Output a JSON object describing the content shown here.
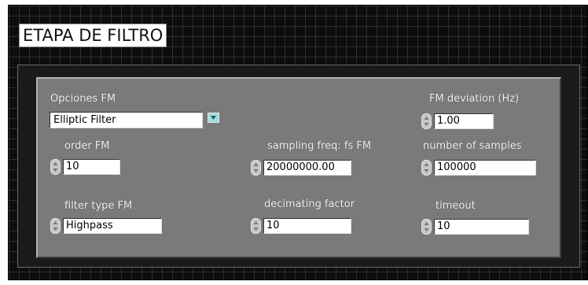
{
  "title": "ETAPA DE FILTRO",
  "opciones_fm": {
    "label": "Opciones FM",
    "value": "Elliptic Filter"
  },
  "order_fm": {
    "label": "order FM",
    "value": "10"
  },
  "filter_type_fm": {
    "label": "filter type FM",
    "value": "Highpass"
  },
  "sampling_freq": {
    "label": "sampling freq: fs FM",
    "value": "20000000.00"
  },
  "decimating_factor": {
    "label": "decimating factor",
    "value": "10"
  },
  "fm_deviation": {
    "label": "FM deviation (Hz)",
    "value": "1.00"
  },
  "number_of_samples": {
    "label": "number of samples",
    "value": "100000"
  },
  "timeout": {
    "label": "timeout",
    "value": "10"
  },
  "colors": {
    "panel": "#7a7a7a",
    "canvas": "#0d0d0d",
    "dropdown_button": "#9edcde"
  }
}
